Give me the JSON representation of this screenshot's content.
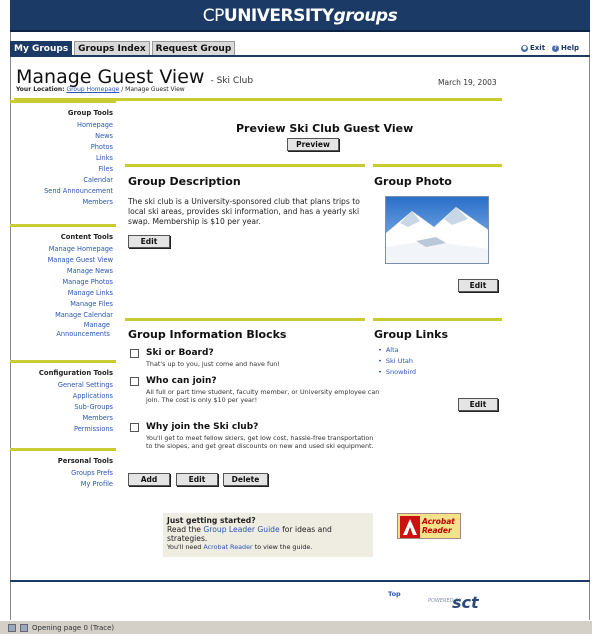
{
  "header": {
    "brand_cp": "CP",
    "brand_university": "UNIVERSITY",
    "brand_groups": "groups"
  },
  "tabs": [
    {
      "label": "My Groups",
      "active": true
    },
    {
      "label": "Groups Index",
      "active": false
    },
    {
      "label": "Request Group",
      "active": false
    }
  ],
  "utility": {
    "exit": "Exit",
    "help": "Help"
  },
  "page": {
    "title": "Manage Guest View",
    "subtitle": "- Ski Club",
    "location_label": "Your Location:",
    "location_link": "Group Homepage",
    "location_current": "/ Manage Guest View",
    "date": "March 19, 2003"
  },
  "sidebar": {
    "sections": [
      {
        "heading": "Group Tools",
        "items": [
          "Homepage",
          "News",
          "Photos",
          "Links",
          "Files",
          "Calendar",
          "Send Announcement",
          "Members"
        ]
      },
      {
        "heading": "Content Tools",
        "items": [
          "Manage Homepage",
          "Manage Guest View",
          "Manage News",
          "Manage Photos",
          "Manage Links",
          "Manage Files",
          "Manage Calendar",
          "Manage Announcements"
        ]
      },
      {
        "heading": "Configuration Tools",
        "items": [
          "General Settings",
          "Applications",
          "Sub-Groups",
          "Members",
          "Permissions"
        ]
      },
      {
        "heading": "Personal Tools",
        "items": [
          "Groups Prefs",
          "My Profile"
        ]
      }
    ]
  },
  "preview": {
    "heading": "Preview Ski Club Guest View",
    "button": "Preview"
  },
  "description": {
    "heading": "Group Description",
    "text": "The ski club is a University-sponsored club that plans trips to local ski areas, provides ski information, and has a yearly ski swap. Membership is $10 per year.",
    "edit": "Edit"
  },
  "photo": {
    "heading": "Group Photo",
    "edit": "Edit"
  },
  "blocks": {
    "heading": "Group Information Blocks",
    "items": [
      {
        "title": "Ski or Board?",
        "desc": "That's up to you, just come and have fun!"
      },
      {
        "title": "Who can join?",
        "desc": "All full or part time student, faculty member, or University employee can join. The cost is only $10 per year!"
      },
      {
        "title": "Why join the Ski club?",
        "desc": "You'll get to meet fellow skiers, get low cost, hassle-free transportation to the slopes, and get great discounts on new and used ski equipment."
      }
    ],
    "add": "Add",
    "edit": "Edit",
    "delete": "Delete"
  },
  "links": {
    "heading": "Group Links",
    "items": [
      "Alta",
      "Ski Utah",
      "Snowbird"
    ],
    "edit": "Edit"
  },
  "getting_started": {
    "heading": "Just getting started?",
    "line1_pre": "Read the",
    "line1_link": "Group Leader Guide",
    "line1_post": "for ideas and strategies.",
    "line2_pre": "You'll need",
    "line2_link": "Acrobat Reader",
    "line2_post": "to view the guide.",
    "acrobat_line1": "Acrobat",
    "acrobat_line2": "Reader"
  },
  "footer": {
    "top": "Top",
    "powered": "POWERED BY",
    "sct": "sct"
  },
  "statusbar": {
    "text": "Opening page 0 (Trace)"
  }
}
